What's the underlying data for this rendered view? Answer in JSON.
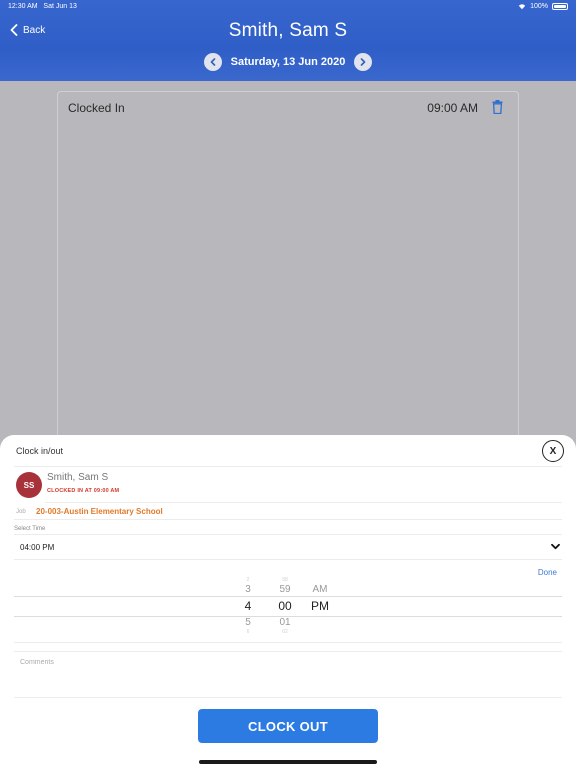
{
  "status_bar": {
    "time": "12:30 AM",
    "date": "Sat Jun 13",
    "battery": "100%"
  },
  "header": {
    "back_label": "Back",
    "title": "Smith, Sam S",
    "date": "Saturday, 13 Jun 2020",
    "color": "#3163cb"
  },
  "entry": {
    "label": "Clocked In",
    "time": "09:00 AM"
  },
  "sheet": {
    "title": "Clock in/out",
    "close_label": "X",
    "employee": {
      "initials": "SS",
      "name": "Smith, Sam S",
      "status": "CLOCKED IN AT 09:00 AM",
      "avatar_color": "#a8323a"
    },
    "job": {
      "label": "Job",
      "value": "20-003-Austin Elementary School"
    },
    "select_time": {
      "label": "Select Time",
      "value": "04:00 PM"
    },
    "done_label": "Done",
    "picker": {
      "hours": {
        "far_above": "2",
        "above": "3",
        "selected": "4",
        "below": "5",
        "far_below": "6"
      },
      "minutes": {
        "far_above": "58",
        "above": "59",
        "selected": "00",
        "below": "01",
        "far_below": "02"
      },
      "period": {
        "above": "AM",
        "selected": "PM"
      }
    },
    "comments_placeholder": "Comments",
    "action_label": "CLOCK OUT",
    "action_color": "#2b7be3"
  }
}
